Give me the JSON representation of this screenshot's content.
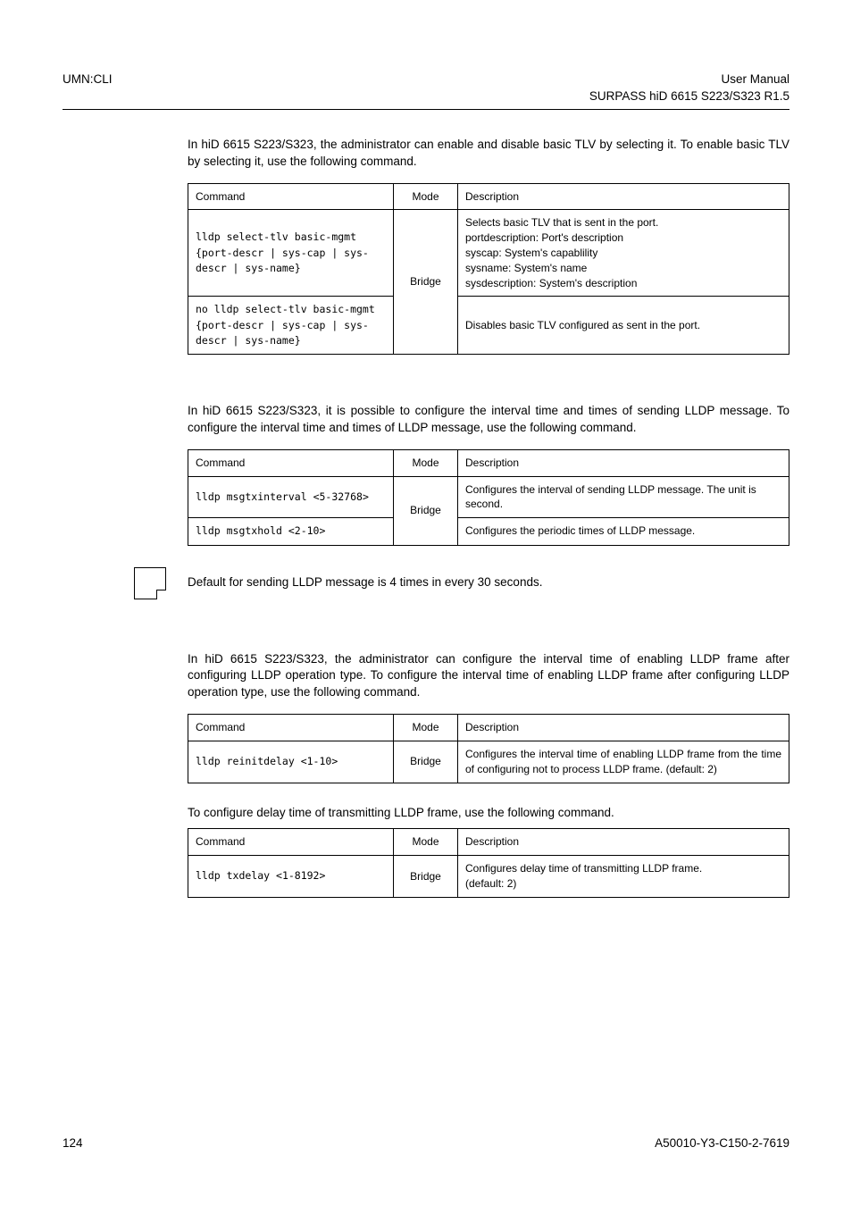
{
  "header": {
    "left": "UMN:CLI",
    "right1": "User Manual",
    "right2": "SURPASS hiD 6615 S223/S323 R1.5"
  },
  "sec1": {
    "p1": "In hiD 6615 S223/S323, the administrator can enable and disable basic TLV by selecting it. To enable basic TLV by selecting it, use the following command.",
    "th": {
      "cmd": "Command",
      "mode": "Mode",
      "desc": "Description"
    },
    "r1": {
      "cmd": "lldp select-tlv basic-mgmt {port-descr | sys-cap | sys-descr | sys-name}",
      "desc1": "Selects basic TLV that is sent in the port.",
      "desc2": "portdescription: Port's description",
      "desc3": "syscap: System's capablility",
      "desc4": "sysname: System's name",
      "desc5": "sysdescription: System's description"
    },
    "mode": "Bridge",
    "r2": {
      "cmd": "no lldp select-tlv basic-mgmt {port-descr | sys-cap | sys-descr | sys-name}",
      "desc": "Disables basic TLV configured as sent in the port."
    }
  },
  "sec2": {
    "p1": "In hiD 6615 S223/S323, it is possible to configure the interval time and times of sending LLDP message. To configure the interval time and times of LLDP message, use the following command.",
    "th": {
      "cmd": "Command",
      "mode": "Mode",
      "desc": "Description"
    },
    "r1": {
      "cmd_pre": "lldp msgtxinterval ",
      "cmd_arg": "<5-32768>",
      "desc": "Configures the interval of sending LLDP message. The unit is second."
    },
    "mode": "Bridge",
    "r2": {
      "cmd_pre": "lldp msgtxhold ",
      "cmd_arg": "<2-10>",
      "desc": "Configures the periodic times of LLDP message."
    },
    "note": "Default for sending LLDP message is 4 times in every 30 seconds."
  },
  "sec3": {
    "p1": "In hiD 6615 S223/S323, the administrator can configure the interval time of enabling LLDP frame after configuring LLDP operation type. To configure the interval time of enabling LLDP frame after configuring LLDP operation type, use the following command.",
    "th": {
      "cmd": "Command",
      "mode": "Mode",
      "desc": "Description"
    },
    "r1": {
      "cmd_pre": "lldp reinitdelay ",
      "cmd_arg": "<1-10>",
      "mode": "Bridge",
      "desc": "Configures the interval time of enabling LLDP frame from the time of configuring not to process LLDP frame. (default: 2)"
    }
  },
  "sec4": {
    "p1": "To configure delay time of transmitting LLDP frame, use the following command.",
    "th": {
      "cmd": "Command",
      "mode": "Mode",
      "desc": "Description"
    },
    "r1": {
      "cmd_pre": "lldp txdelay ",
      "cmd_arg": "<1-8192>",
      "mode": "Bridge",
      "desc1": "Configures delay time of transmitting LLDP frame.",
      "desc2": "(default: 2)"
    }
  },
  "footer": {
    "page": "124",
    "doc": "A50010-Y3-C150-2-7619"
  }
}
